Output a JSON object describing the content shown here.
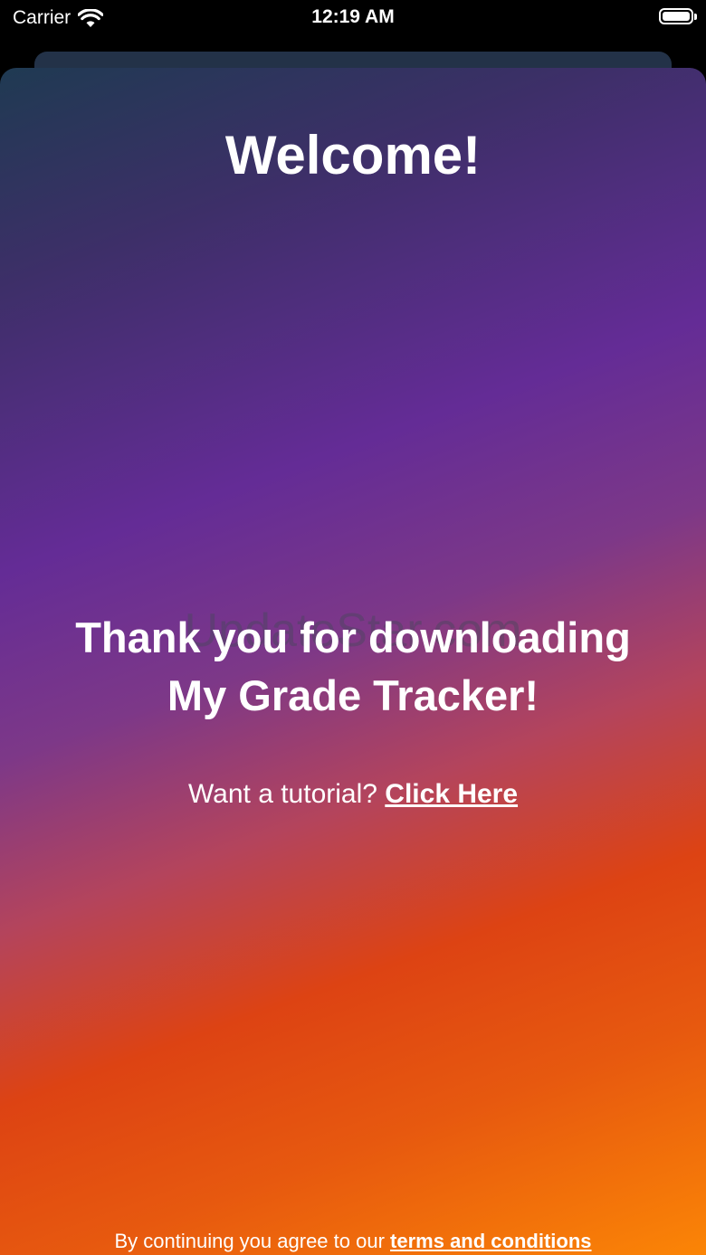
{
  "status_bar": {
    "carrier": "Carrier",
    "time": "12:19 AM",
    "wifi_icon": "wifi-icon",
    "battery_icon": "battery-icon",
    "battery_level": 1.0
  },
  "welcome": {
    "title": "Welcome!",
    "watermark": "UpdateStar.com",
    "thanks_line1": "Thank you for downloading",
    "thanks_line2": "My Grade Tracker!",
    "tutorial_prompt": "Want a tutorial?",
    "tutorial_link": "Click Here",
    "terms_prompt": "By continuing you agree to our",
    "terms_link": "terms and conditions"
  },
  "colors": {
    "gradient_top": "#1f3a52",
    "gradient_purple": "#642c96",
    "gradient_red": "#dd4313",
    "gradient_bottom": "#fb8506",
    "text": "#ffffff"
  }
}
